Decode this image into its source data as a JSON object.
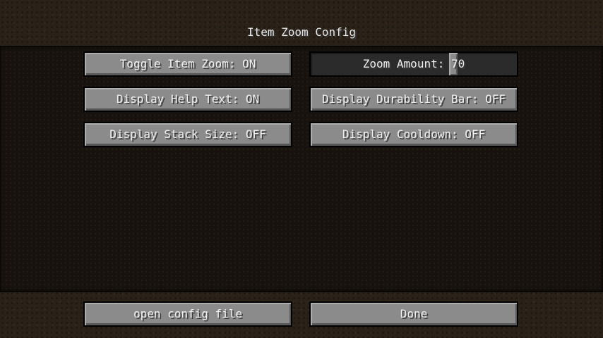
{
  "screen": {
    "title": "Item Zoom Config"
  },
  "options": {
    "toggle_item_zoom": "Toggle Item Zoom: ON",
    "display_help_text": "Display Help Text: ON",
    "display_stack_size": "Display Stack Size: OFF",
    "display_durability_bar": "Display Durability Bar: OFF",
    "display_cooldown": "Display Cooldown: OFF"
  },
  "zoom_slider": {
    "label": "Zoom Amount: 70",
    "value": 70,
    "min": 0,
    "max": 100
  },
  "footer": {
    "open_config_label": "open config file",
    "done_label": "Done"
  }
}
